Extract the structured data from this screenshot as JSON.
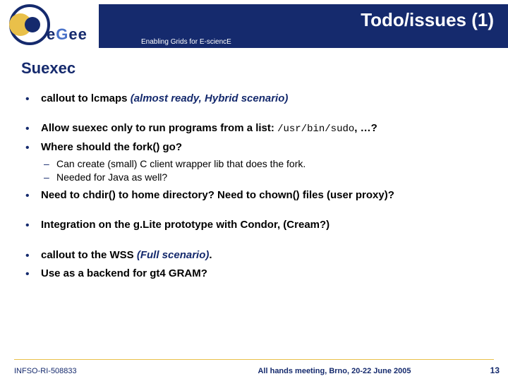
{
  "header": {
    "title": "Todo/issues (1)",
    "subtitle": "Enabling Grids for E-sciencE"
  },
  "logo": {
    "text_prefix": "e",
    "text_mid": "G",
    "text_suffix": "ee"
  },
  "body": {
    "section_heading": "Suexec",
    "items": {
      "b1_prefix": "callout to lcmaps ",
      "b1_ital": "(almost ready, Hybrid scenario)",
      "b2_bold": "Allow suexec only to run programs from a list: ",
      "b2_code": "/usr/bin/sudo",
      "b2_rest": ", …?",
      "b3": "Where should the fork() go?",
      "b3_sub1": "Can create (small) C client wrapper lib that does the fork.",
      "b3_sub2": "Needed for Java as well?",
      "b4": "Need to chdir() to home directory? Need to chown() files (user proxy)?",
      "b5": "Integration on the g.Lite prototype with Condor, (Cream?)",
      "b6_prefix": "callout to the WSS ",
      "b6_ital": "(Full scenario)",
      "b6_dot": ".",
      "b7": "Use as a backend for gt4 GRAM?"
    }
  },
  "footer": {
    "left": "INFSO-RI-508833",
    "center": "All hands meeting, Brno, 20-22 June 2005",
    "page": "13"
  }
}
